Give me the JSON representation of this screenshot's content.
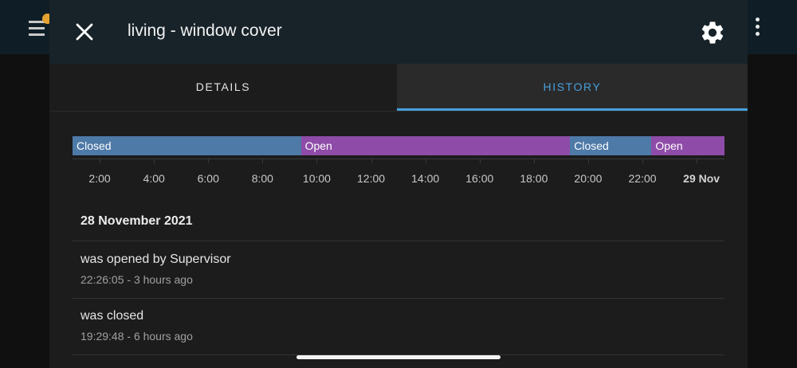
{
  "dialog": {
    "title": "living - window cover",
    "close_icon": "close-icon",
    "settings_icon": "gear-icon"
  },
  "tabs": [
    {
      "label": "DETAILS",
      "active": false
    },
    {
      "label": "HISTORY",
      "active": true
    }
  ],
  "colors": {
    "accent": "#47a0dd",
    "closed": "#4e7aa8",
    "open": "#8e4ca8",
    "header": "#172329",
    "dialog_bg": "#1c1c1c"
  },
  "timeline": {
    "segments": [
      {
        "state": "Closed",
        "start": "1:00",
        "end": "9:25",
        "color": "#4e7aa8"
      },
      {
        "state": "Open",
        "start": "9:25",
        "end": "19:20",
        "color": "#8e4ca8"
      },
      {
        "state": "Closed",
        "start": "19:20",
        "end": "22:20",
        "color": "#4e7aa8"
      },
      {
        "state": "Open",
        "start": "22:20",
        "end": "25:20",
        "color": "#8e4ca8"
      }
    ],
    "ticks": [
      "2:00",
      "4:00",
      "6:00",
      "8:00",
      "10:00",
      "12:00",
      "14:00",
      "16:00",
      "18:00",
      "20:00",
      "22:00",
      "29 Nov"
    ]
  },
  "logbook": {
    "date": "28 November 2021",
    "entries": [
      {
        "message": "was opened by Supervisor",
        "time": "22:26:05 - 3 hours ago"
      },
      {
        "message": "was closed",
        "time": "19:29:48 - 6 hours ago"
      }
    ]
  }
}
